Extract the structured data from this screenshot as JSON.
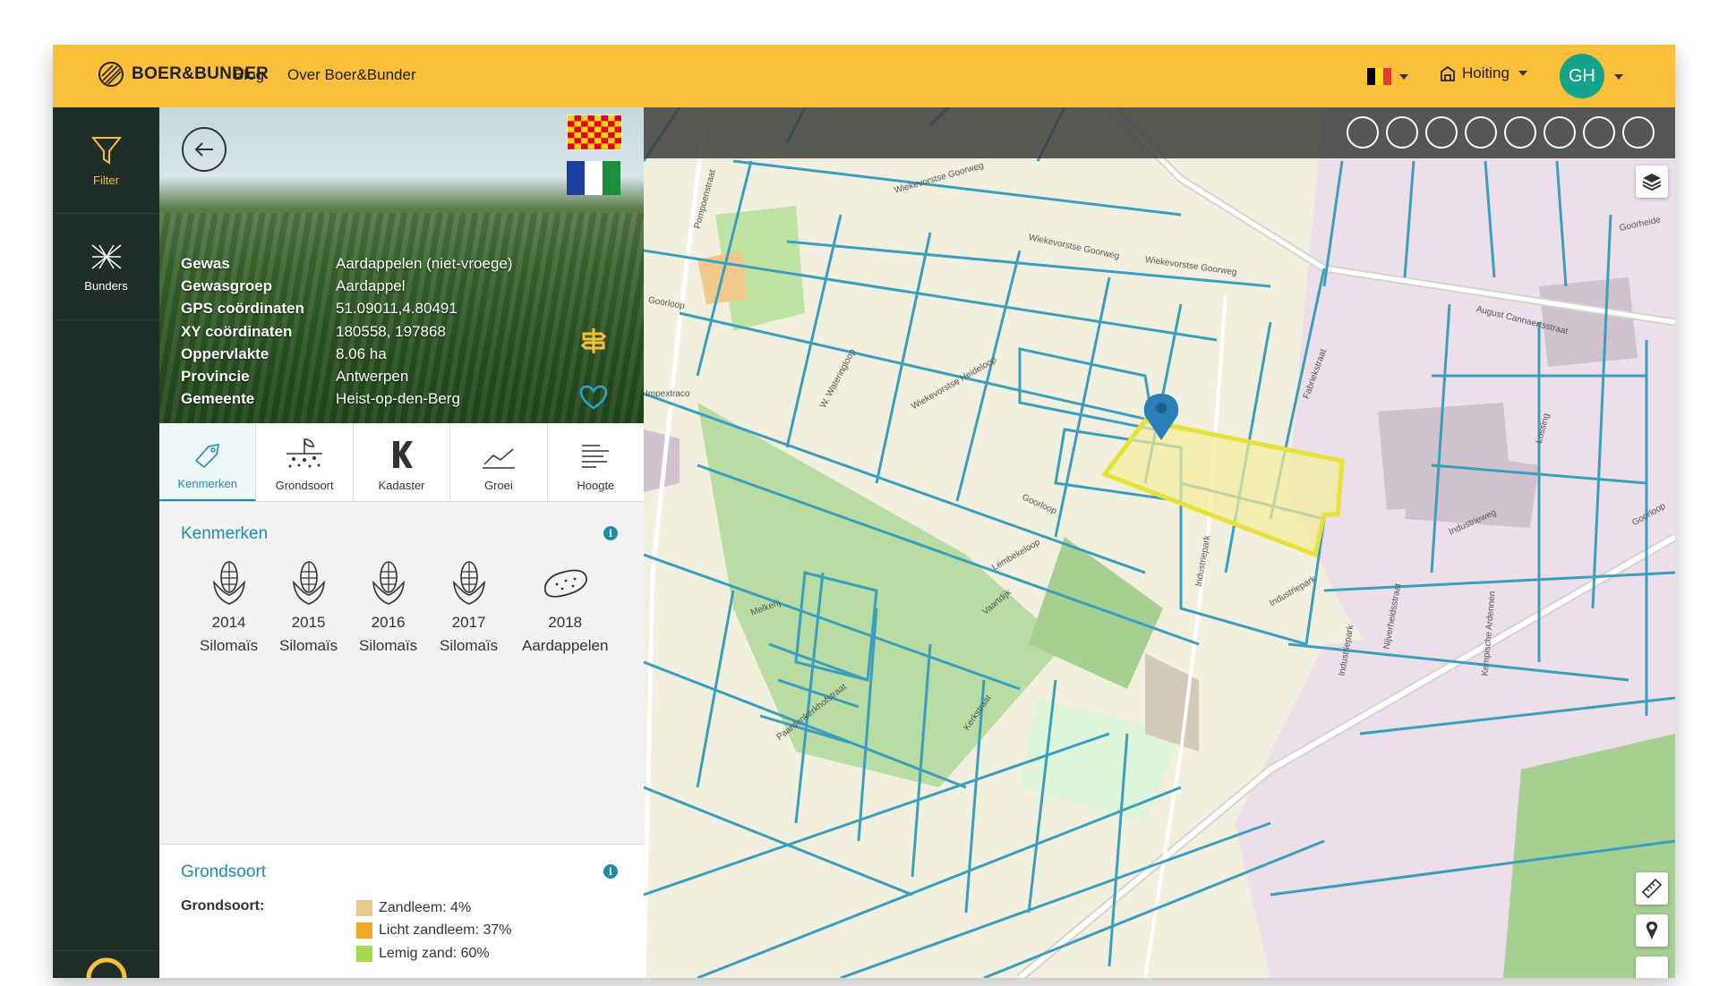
{
  "topbar": {
    "logo": "BOER&BUNDER",
    "nav": [
      "Blog",
      "Over Boer&Bunder"
    ],
    "farm": "Hoiting",
    "avatar_initials": "GH",
    "colors": {
      "bar": "#fbbf3a",
      "avatar": "#14a38a"
    }
  },
  "sidebar": {
    "items": [
      {
        "label": "Filter",
        "icon": "filter-icon"
      },
      {
        "label": "Bunders",
        "icon": "bunders-icon"
      }
    ]
  },
  "parcel": {
    "fields": [
      {
        "key": "Gewas",
        "value": "Aardappelen (niet-vroege)"
      },
      {
        "key": "Gewasgroep",
        "value": "Aardappel"
      },
      {
        "key": "GPS coördinaten",
        "value": "51.09011,4.80491"
      },
      {
        "key": "XY coördinaten",
        "value": "180558, 197868"
      },
      {
        "key": "Oppervlakte",
        "value": "8.06 ha"
      },
      {
        "key": "Provincie",
        "value": "Antwerpen"
      },
      {
        "key": "Gemeente",
        "value": "Heist-op-den-Berg"
      }
    ]
  },
  "tabs": [
    {
      "label": "Kenmerken",
      "icon": "tag-icon"
    },
    {
      "label": "Grondsoort",
      "icon": "soil-icon"
    },
    {
      "label": "Kadaster",
      "icon": "kadaster-icon"
    },
    {
      "label": "Groei",
      "icon": "growth-chart-icon"
    },
    {
      "label": "Hoogte",
      "icon": "height-lines-icon"
    }
  ],
  "kenmerken": {
    "title": "Kenmerken",
    "crops": [
      {
        "year": "2014",
        "crop": "Silomaïs",
        "icon": "corn-icon"
      },
      {
        "year": "2015",
        "crop": "Silomaïs",
        "icon": "corn-icon"
      },
      {
        "year": "2016",
        "crop": "Silomaïs",
        "icon": "corn-icon"
      },
      {
        "year": "2017",
        "crop": "Silomaïs",
        "icon": "corn-icon"
      },
      {
        "year": "2018",
        "crop": "Aardappelen",
        "icon": "potato-icon"
      }
    ]
  },
  "grondsoort": {
    "title": "Grondsoort",
    "label": "Grondsoort:",
    "items": [
      {
        "text": "Zandleem: 4%",
        "color": "#e8c98c"
      },
      {
        "text": "Licht zandleem: 37%",
        "color": "#f5a623"
      },
      {
        "text": "Lemig zand: 60%",
        "color": "#a6d94a"
      }
    ]
  },
  "map": {
    "streets": [
      "Wiekevorstse Goorweg",
      "Wiekevorstse Goorweg",
      "Wiekevorstse Goorweg",
      "August Cannaertsstraat",
      "Wiekevorstse Heideloop",
      "W. Wateringloop",
      "Goorloop",
      "Impextraco",
      "Industrieweg",
      "Industriepark",
      "Industriepark",
      "Lossing",
      "Lembekeloop",
      "Vaartdijk",
      "Fabriekstraat",
      "Kerkstraat",
      "Kempische Ardennen",
      "Industriepark",
      "Nijverheidsstraat",
      "Paardenkerkhofstraat",
      "Melkerij",
      "Pompoenstraat",
      "Goorloop",
      "Goorloop",
      "Goorheide"
    ],
    "colors": {
      "parcel_stroke": "#3a9fbf",
      "selected": "#e6e23a",
      "industrial": "#e9dbe6",
      "meadow": "#bfe3a3",
      "forest": "#a6cf92"
    }
  }
}
